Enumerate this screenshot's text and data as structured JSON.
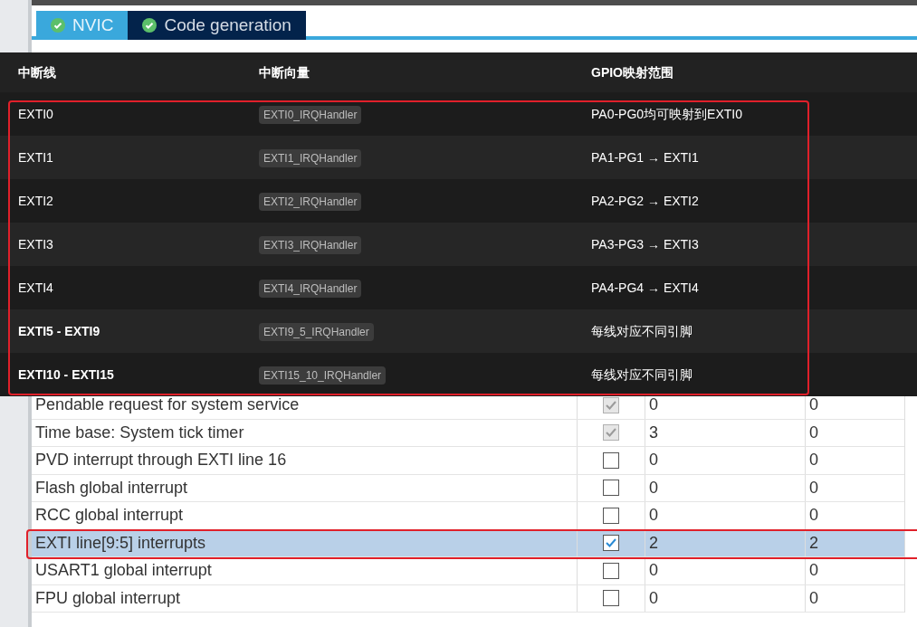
{
  "tabs": [
    {
      "label": "NVIC",
      "selected": false
    },
    {
      "label": "Code generation",
      "selected": true
    }
  ],
  "overlay": {
    "columns": [
      "中断线",
      "中断向量",
      "GPIO映射范围"
    ],
    "rows": [
      {
        "line": "EXTI0",
        "handler": "EXTI0_IRQHandler",
        "gpio": "PA0-PG0均可映射到EXTI0",
        "kind": "single"
      },
      {
        "line": "EXTI1",
        "handler": "EXTI1_IRQHandler",
        "gpio": "PA1-PG1 → EXTI1",
        "kind": "single"
      },
      {
        "line": "EXTI2",
        "handler": "EXTI2_IRQHandler",
        "gpio": "PA2-PG2 → EXTI2",
        "kind": "single"
      },
      {
        "line": "EXTI3",
        "handler": "EXTI3_IRQHandler",
        "gpio": "PA3-PG3 → EXTI3",
        "kind": "single"
      },
      {
        "line": "EXTI4",
        "handler": "EXTI4_IRQHandler",
        "gpio": "PA4-PG4 → EXTI4",
        "kind": "single"
      },
      {
        "line": "EXTI5 - EXTI9",
        "handler": "EXTI9_5_IRQHandler",
        "gpio": "每线对应不同引脚",
        "kind": "group"
      },
      {
        "line": "EXTI10 - EXTI15",
        "handler": "EXTI15_10_IRQHandler",
        "gpio": "每线对应不同引脚",
        "kind": "group"
      }
    ]
  },
  "interrupts": [
    {
      "name": "Pendable request for system service",
      "enabled": true,
      "disabled": true,
      "preemption": "0",
      "sub": "0",
      "selected": false
    },
    {
      "name": "Time base: System tick timer",
      "enabled": true,
      "disabled": true,
      "preemption": "3",
      "sub": "0",
      "selected": false
    },
    {
      "name": "PVD interrupt through EXTI line 16",
      "enabled": false,
      "disabled": false,
      "preemption": "0",
      "sub": "0",
      "selected": false
    },
    {
      "name": "Flash global interrupt",
      "enabled": false,
      "disabled": false,
      "preemption": "0",
      "sub": "0",
      "selected": false
    },
    {
      "name": "RCC global interrupt",
      "enabled": false,
      "disabled": false,
      "preemption": "0",
      "sub": "0",
      "selected": false
    },
    {
      "name": "EXTI line[9:5] interrupts",
      "enabled": true,
      "disabled": false,
      "preemption": "2",
      "sub": "2",
      "selected": true
    },
    {
      "name": "USART1 global interrupt",
      "enabled": false,
      "disabled": false,
      "preemption": "0",
      "sub": "0",
      "selected": false
    },
    {
      "name": "FPU global interrupt",
      "enabled": false,
      "disabled": false,
      "preemption": "0",
      "sub": "0",
      "selected": false
    }
  ]
}
